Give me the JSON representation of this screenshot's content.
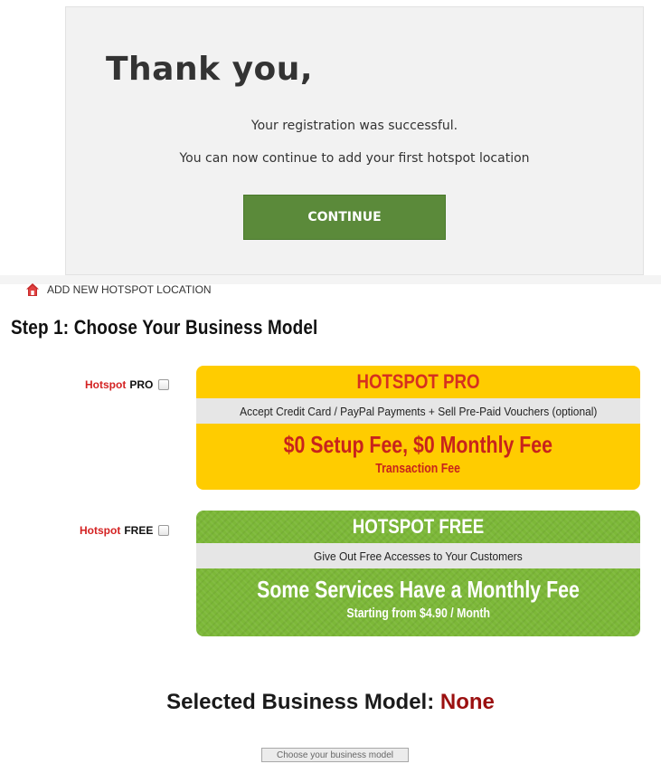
{
  "thanks": {
    "title": "Thank you,",
    "line1": "Your registration was successful.",
    "line2": "You can now continue to add your first hotspot location",
    "continue_label": "CONTINUE"
  },
  "header": {
    "icon": "home-icon",
    "label": "ADD NEW HOTSPOT LOCATION"
  },
  "step": {
    "title": "Step 1: Choose Your Business Model"
  },
  "options": [
    {
      "label_red": "Hotspot",
      "label_dark": "PRO",
      "checked": false,
      "head": "HOTSPOT PRO",
      "strip": "Accept Credit Card / PayPal Payments + Sell Pre-Paid Vouchers (optional)",
      "main": "$0 Setup Fee, $0 Monthly Fee",
      "sub": "Transaction Fee"
    },
    {
      "label_red": "Hotspot",
      "label_dark": "FREE",
      "checked": false,
      "head": "HOTSPOT FREE",
      "strip": "Give Out Free Accesses to Your Customers",
      "main": "Some Services Have a Monthly Fee",
      "sub": "Starting from $4.90 / Month"
    }
  ],
  "selected": {
    "label": "Selected Business Model:",
    "value": "None"
  },
  "choose_button": "Choose your business model",
  "colors": {
    "continue": "#5b8a3a",
    "pro_panel": "#ffcc00",
    "free_panel": "#7cb838",
    "red_accent": "#d42222",
    "selected_value": "#9b1010"
  }
}
